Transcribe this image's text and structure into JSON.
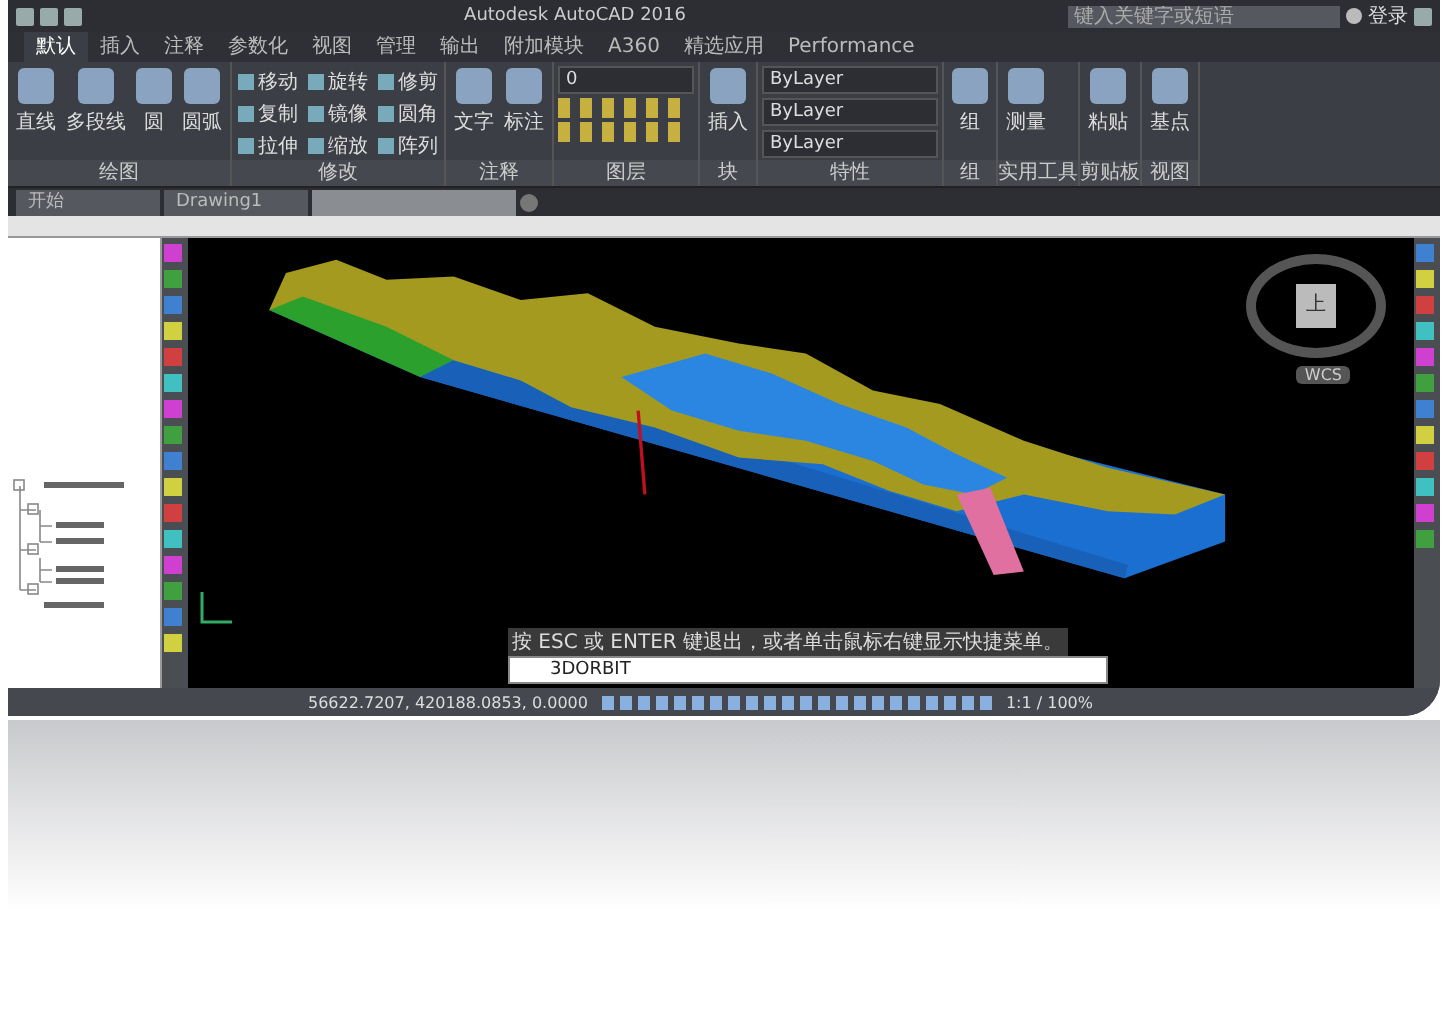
{
  "title_bar": {
    "app_title": "Autodesk AutoCAD 2016",
    "search_placeholder": "键入关键字或短语",
    "sign_in": "登录"
  },
  "ribbon_tabs": [
    {
      "label": "默认",
      "selected": true
    },
    {
      "label": "插入",
      "selected": false
    },
    {
      "label": "注释",
      "selected": false
    },
    {
      "label": "参数化",
      "selected": false
    },
    {
      "label": "视图",
      "selected": false
    },
    {
      "label": "管理",
      "selected": false
    },
    {
      "label": "输出",
      "selected": false
    },
    {
      "label": "附加模块",
      "selected": false
    },
    {
      "label": "A360",
      "selected": false
    },
    {
      "label": "精选应用",
      "selected": false
    },
    {
      "label": "Performance",
      "selected": false
    }
  ],
  "ribbon_panels": [
    {
      "kind": "large",
      "title": "绘图",
      "tools": [
        "直线",
        "多段线",
        "圆",
        "圆弧"
      ]
    },
    {
      "kind": "small",
      "title": "修改",
      "tools": [
        "移动",
        "旋转",
        "修剪",
        "复制",
        "镜像",
        "圆角",
        "拉伸",
        "缩放",
        "阵列"
      ]
    },
    {
      "kind": "large",
      "title": "注释",
      "tools": [
        "文字",
        "标注"
      ]
    },
    {
      "kind": "layers",
      "title": "图层",
      "value": "0"
    },
    {
      "kind": "large",
      "title": "块",
      "tools": [
        "插入"
      ]
    },
    {
      "kind": "properties",
      "title": "特性",
      "values": [
        "ByLayer",
        "ByLayer",
        "ByLayer"
      ]
    },
    {
      "kind": "large",
      "title": "组",
      "tools": [
        "组"
      ]
    },
    {
      "kind": "large",
      "title": "实用工具",
      "tools": [
        "测量"
      ]
    },
    {
      "kind": "large",
      "title": "剪贴板",
      "tools": [
        "粘贴"
      ]
    },
    {
      "kind": "large",
      "title": "视图",
      "tools": [
        "基点"
      ]
    }
  ],
  "document_tabs": [
    {
      "label": "开始",
      "selected": false
    },
    {
      "label": "Drawing1",
      "selected": false
    },
    {
      "selected": true
    }
  ],
  "viewport": {
    "viewcube_top": "上",
    "coordinate_system": "WCS"
  },
  "command_line": {
    "history": "按 ESC 或 ENTER 键退出，或者单击鼠标右键显示快捷菜单。",
    "input": "3DORBIT"
  },
  "status_bar": {
    "coordinates": "56622.7207, 420188.0853, 0.0000",
    "scale": "1:1 / 100%"
  }
}
